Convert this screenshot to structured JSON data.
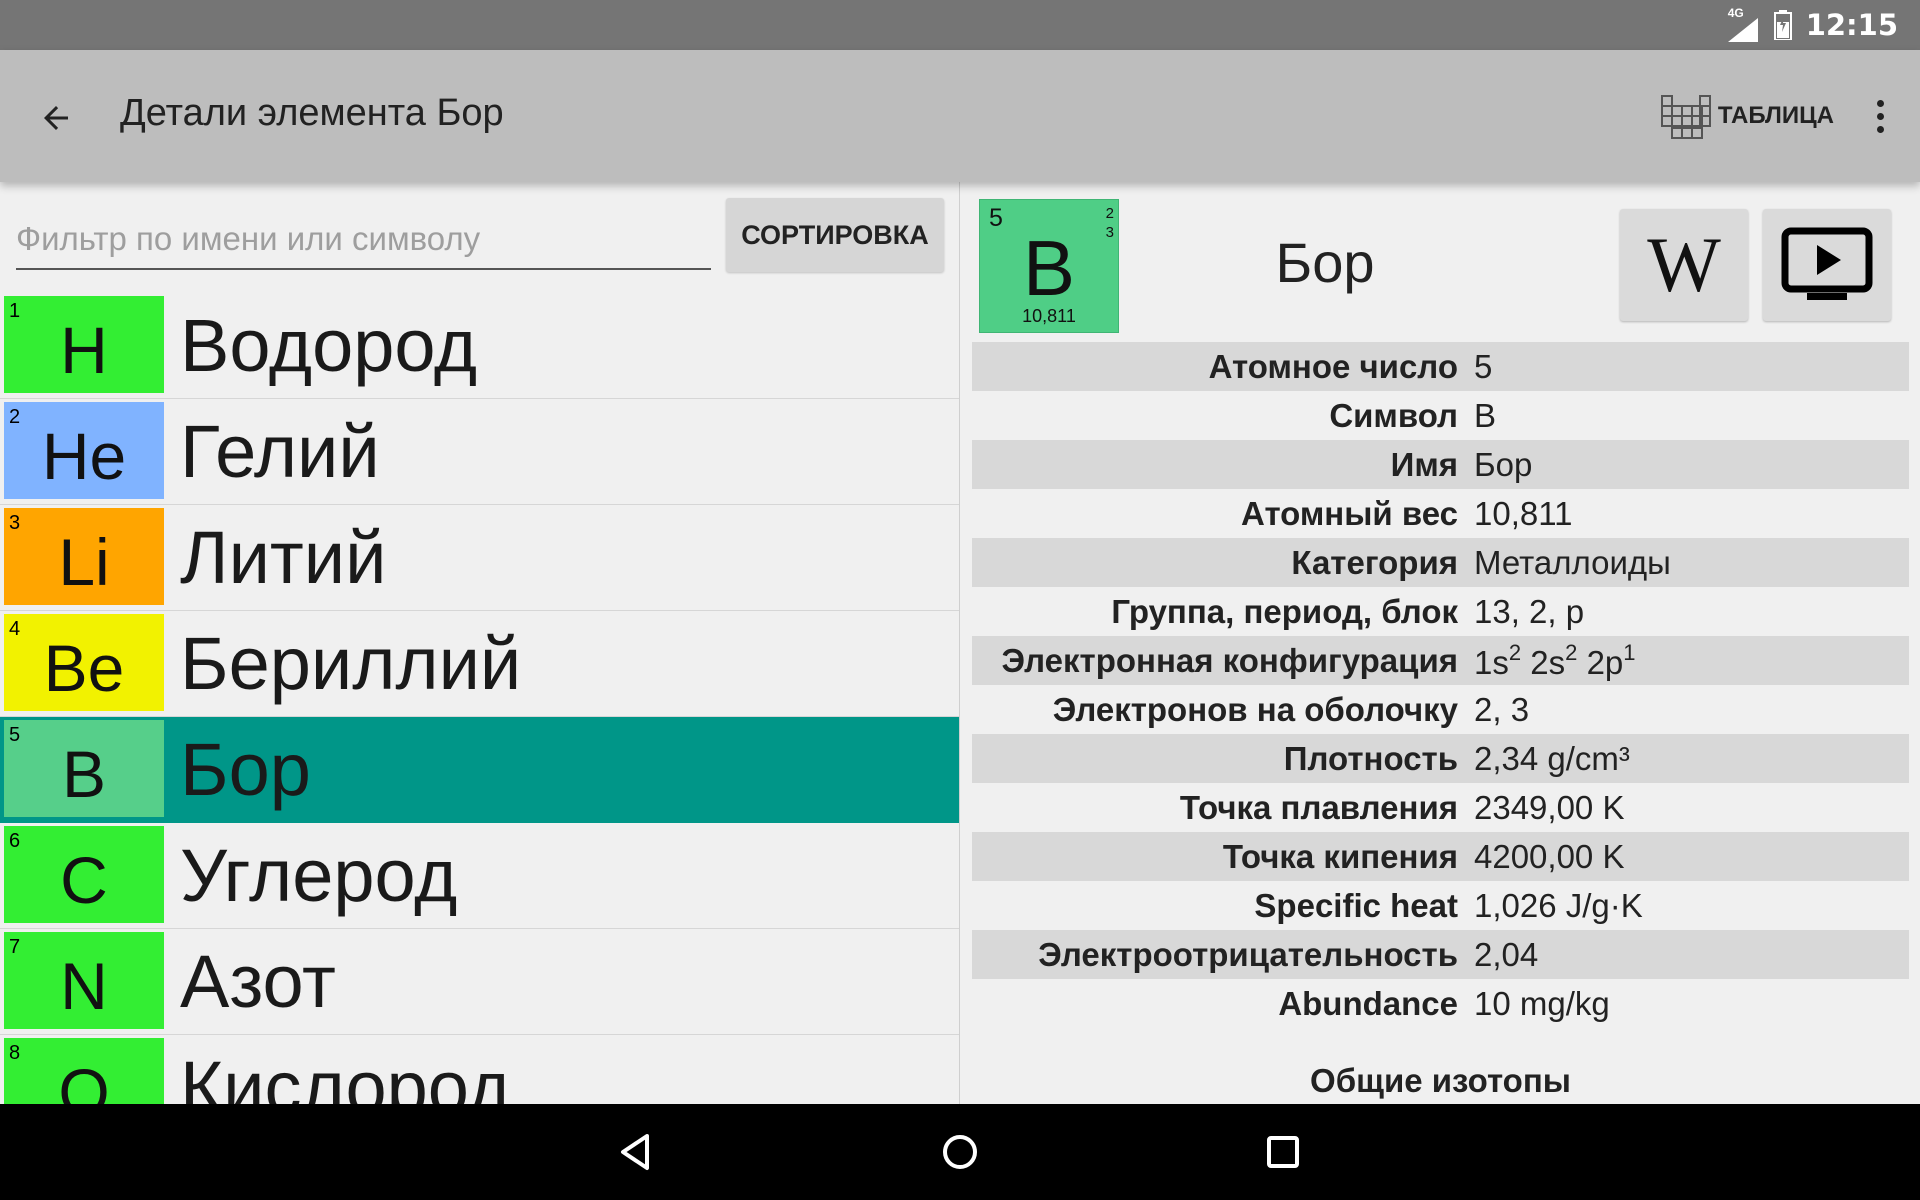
{
  "status_bar": {
    "network": "4G",
    "time": "12:15"
  },
  "app_bar": {
    "title": "Детали элемента Бор",
    "table_label": "ТАБЛИЦА"
  },
  "filter": {
    "placeholder": "Фильтр по имени или символу",
    "value": ""
  },
  "sort_label": "СОРТИРОВКА",
  "elements": [
    {
      "number": "1",
      "symbol": "H",
      "name": "Водород",
      "color": "#33ee33",
      "selected": false
    },
    {
      "number": "2",
      "symbol": "He",
      "name": "Гелий",
      "color": "#80b3ff",
      "selected": false
    },
    {
      "number": "3",
      "symbol": "Li",
      "name": "Литий",
      "color": "#ffa500",
      "selected": false
    },
    {
      "number": "4",
      "symbol": "Be",
      "name": "Бериллий",
      "color": "#f2f200",
      "selected": false
    },
    {
      "number": "5",
      "symbol": "B",
      "name": "Бор",
      "color": "#56cf8a",
      "selected": true
    },
    {
      "number": "6",
      "symbol": "C",
      "name": "Углерод",
      "color": "#33ee33",
      "selected": false
    },
    {
      "number": "7",
      "symbol": "N",
      "name": "Азот",
      "color": "#33ee33",
      "selected": false
    },
    {
      "number": "8",
      "symbol": "O",
      "name": "Кислород",
      "color": "#33ee33",
      "selected": false
    }
  ],
  "detail": {
    "tile": {
      "number": "5",
      "symbol": "B",
      "weight": "10,811",
      "shell_1": "2",
      "shell_2": "3",
      "color": "#4fce86"
    },
    "name": "Бор",
    "wiki_icon": "W",
    "properties": [
      {
        "label": "Атомное число",
        "value": "5"
      },
      {
        "label": "Символ",
        "value": "B"
      },
      {
        "label": "Имя",
        "value": "Бор"
      },
      {
        "label": "Атомный вес",
        "value": "10,811"
      },
      {
        "label": "Категория",
        "value": "Металлоиды"
      },
      {
        "label": "Группа, период, блок",
        "value": "13, 2, p"
      },
      {
        "label": "Электронная конфигурация",
        "config": [
          {
            "base": "1s",
            "sup": "2"
          },
          {
            "base": "2s",
            "sup": "2"
          },
          {
            "base": "2p",
            "sup": "1"
          }
        ]
      },
      {
        "label": "Электронов на оболочку",
        "value": "2, 3"
      },
      {
        "label": "Плотность",
        "value": "2,34 g/cm³"
      },
      {
        "label": "Точка плавления",
        "value": "2349,00 K"
      },
      {
        "label": "Точка кипения",
        "value": "4200,00 K"
      },
      {
        "label": "Specific heat",
        "value": "1,026 J/g·K"
      },
      {
        "label": "Электроотрицательность",
        "value": "2,04"
      },
      {
        "label": "Abundance",
        "value": "10 mg/kg"
      }
    ],
    "isotopes_heading": "Общие изотопы"
  },
  "colors": {
    "status_bar": "#757575",
    "app_bar": "#bdbdbd",
    "selected_row": "#009688",
    "background": "#f0f0f0",
    "nav_bar": "#000000"
  },
  "icons": {
    "back": "arrow-back-icon",
    "table": "periodic-table-icon",
    "more": "more-vert-icon",
    "wiki": "wikipedia-icon",
    "video": "video-play-icon",
    "nav_back": "nav-back-icon",
    "nav_home": "nav-home-icon",
    "nav_recents": "nav-recents-icon"
  }
}
